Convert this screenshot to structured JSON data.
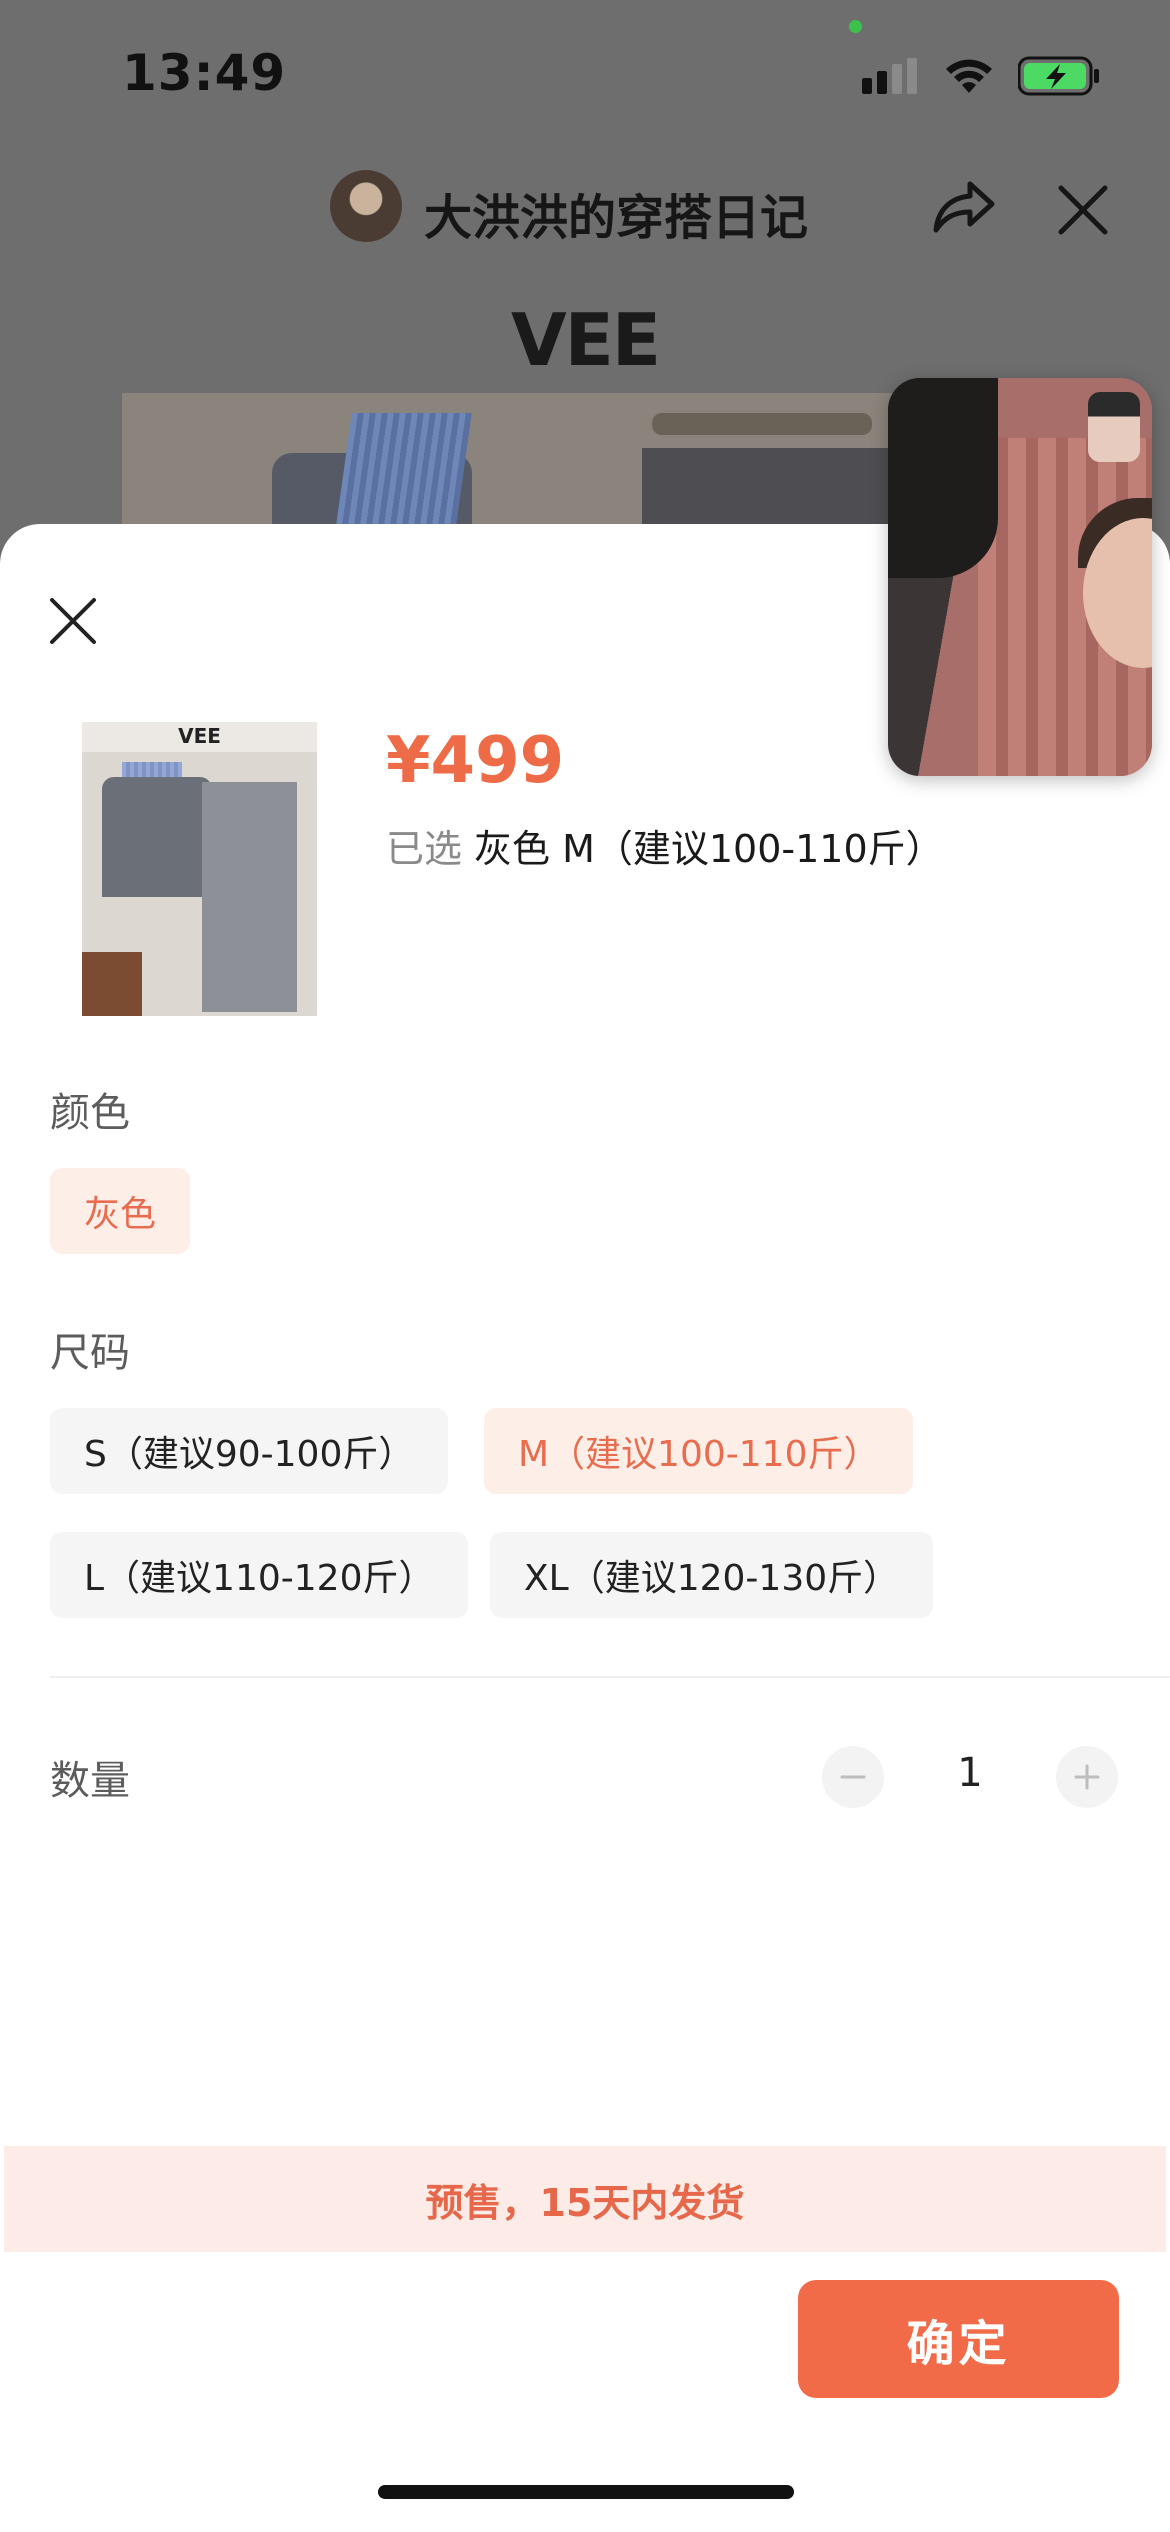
{
  "status_bar": {
    "time": "13:49",
    "icons": [
      "cellular-signal-icon",
      "wifi-icon",
      "battery-charging-icon"
    ],
    "battery_color": "#4cd964"
  },
  "background_page": {
    "shop_name": "大洪洪的穿搭日记",
    "brand": "VEE",
    "icons": [
      "share-icon",
      "close-icon"
    ]
  },
  "sheet": {
    "close_icon": "close-icon",
    "product": {
      "image_logo": "VEE",
      "price": "¥499",
      "selected_label": "已选",
      "selected_value": "灰色 M（建议100-110斤）"
    },
    "color_section": {
      "label": "颜色",
      "options": [
        {
          "label": "灰色",
          "selected": true
        }
      ]
    },
    "size_section": {
      "label": "尺码",
      "options": [
        {
          "label": "S（建议90-100斤）",
          "selected": false
        },
        {
          "label": "M（建议100-110斤）",
          "selected": true
        },
        {
          "label": "L（建议110-120斤）",
          "selected": false
        },
        {
          "label": "XL（建议120-130斤）",
          "selected": false
        }
      ]
    },
    "quantity": {
      "label": "数量",
      "value": "1",
      "minus_icon": "minus-icon",
      "plus_icon": "plus-icon"
    },
    "presale_notice": "预售，15天内发货",
    "confirm_label": "确定"
  },
  "colors": {
    "accent": "#f26b48",
    "accent_text": "#e86d4f",
    "chip_selected_bg": "#fdeee8",
    "chip_bg": "#f5f5f5",
    "presale_bg": "#fcebe6"
  }
}
